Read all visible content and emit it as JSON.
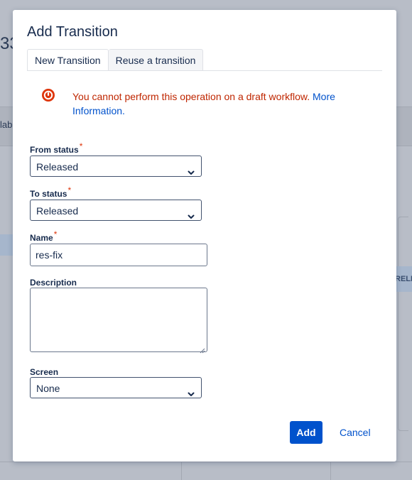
{
  "background": {
    "title_fragment": "33",
    "label_fragment": "lab",
    "node_fragment": "RELE"
  },
  "modal": {
    "title": "Add Transition",
    "tabs": [
      {
        "label": "New Transition",
        "active": true
      },
      {
        "label": "Reuse a transition",
        "active": false
      }
    ],
    "error": {
      "message": "You cannot perform this operation on a draft workflow.",
      "link_text": "More Information."
    },
    "form": {
      "from_status": {
        "label": "From status",
        "required_mark": "*",
        "value": "Released"
      },
      "to_status": {
        "label": "To status",
        "required_mark": "*",
        "value": "Released"
      },
      "name": {
        "label": "Name",
        "required_mark": "*",
        "value": "res-fix"
      },
      "description": {
        "label": "Description",
        "value": ""
      },
      "screen": {
        "label": "Screen",
        "value": "None"
      }
    },
    "buttons": {
      "add": "Add",
      "cancel": "Cancel"
    }
  },
  "colors": {
    "primary": "#0052cc",
    "error": "#bf2600",
    "required": "#de350b"
  }
}
